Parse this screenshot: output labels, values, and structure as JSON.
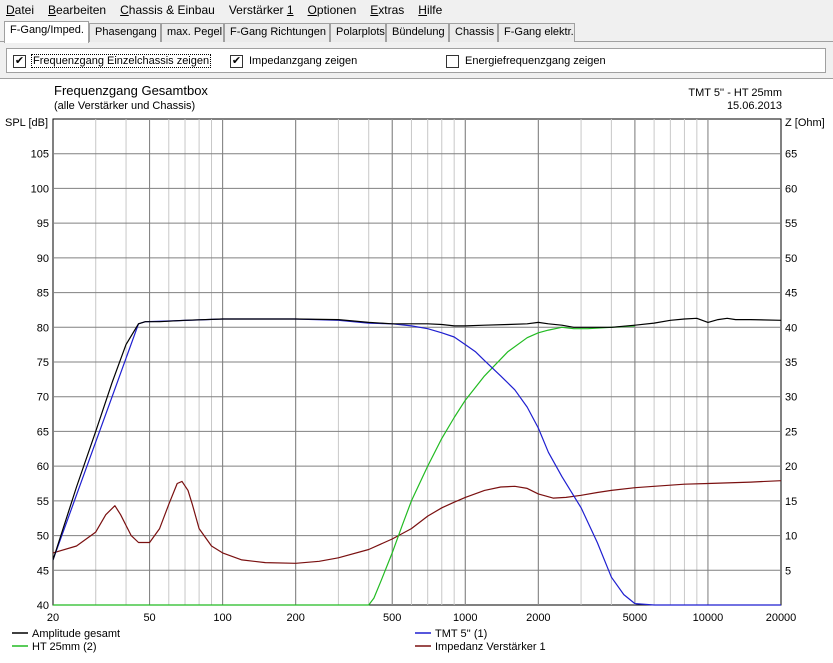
{
  "menu": {
    "items": [
      {
        "label": "Datei",
        "u": "D",
        "rest": "atei"
      },
      {
        "label": "Bearbeiten",
        "u": "B",
        "rest": "earbeiten"
      },
      {
        "label": "Chassis & Einbau",
        "u": "C",
        "rest": "hassis & Einbau"
      },
      {
        "label": "Verstärker 1",
        "u": "",
        "rest": "Verstärker 1"
      },
      {
        "label": "Optionen",
        "u": "O",
        "rest": "ptionen"
      },
      {
        "label": "Extras",
        "u": "E",
        "rest": "xtras"
      },
      {
        "label": "Hilfe",
        "u": "H",
        "rest": "ilfe"
      }
    ]
  },
  "tabs": [
    {
      "label": "F-Gang/Imped.",
      "active": true
    },
    {
      "label": "Phasengang",
      "active": false
    },
    {
      "label": "max. Pegel",
      "active": false
    },
    {
      "label": "F-Gang Richtungen",
      "active": false
    },
    {
      "label": "Polarplots",
      "active": false
    },
    {
      "label": "Bündelung",
      "active": false
    },
    {
      "label": "Chassis",
      "active": false
    },
    {
      "label": "F-Gang elektr.",
      "active": false
    }
  ],
  "options": {
    "show_chassis": {
      "label": "Frequenzgang Einzelchassis zeigen",
      "checked": true
    },
    "show_impedance": {
      "label": "Impedanzgang zeigen",
      "checked": true
    },
    "show_energy": {
      "label": "Energiefrequenzgang zeigen",
      "checked": false
    }
  },
  "chart_data": {
    "type": "line",
    "title": "Frequenzgang Gesamtbox",
    "subtitle": "(alle Verstärker und Chassis)",
    "info_line1": "TMT 5'' - HT 25mm",
    "info_line2": "15.06.2013",
    "ylabel": "SPL [dB]",
    "y2label": "Z [Ohm]",
    "x_scale": "log",
    "xlim": [
      20,
      20000
    ],
    "ylim": [
      40,
      110
    ],
    "y2lim": [
      0,
      70
    ],
    "x_ticks": [
      20,
      50,
      100,
      200,
      500,
      1000,
      2000,
      5000,
      10000,
      20000
    ],
    "y_ticks": [
      40,
      45,
      50,
      55,
      60,
      65,
      70,
      75,
      80,
      85,
      90,
      95,
      100,
      105
    ],
    "y2_ticks": [
      5,
      10,
      15,
      20,
      25,
      30,
      35,
      40,
      45,
      50,
      55,
      60,
      65
    ],
    "grid": true,
    "legend_position": "bottom",
    "series": [
      {
        "name": "Amplitude gesamt",
        "color": "#000000",
        "axis": "left",
        "x": [
          20,
          25,
          30,
          35,
          40,
          45,
          48,
          55,
          70,
          100,
          150,
          200,
          300,
          400,
          500,
          600,
          700,
          800,
          900,
          1000,
          1200,
          1500,
          1800,
          2000,
          2200,
          2500,
          2800,
          3200,
          4000,
          5000,
          6000,
          7000,
          8000,
          9000,
          10000,
          11000,
          12000,
          13000,
          15000,
          20000
        ],
        "y": [
          46.5,
          57,
          65,
          72,
          77.5,
          80.5,
          80.8,
          80.8,
          81.0,
          81.2,
          81.2,
          81.2,
          81.1,
          80.7,
          80.5,
          80.5,
          80.5,
          80.4,
          80.2,
          80.2,
          80.3,
          80.4,
          80.5,
          80.7,
          80.5,
          80.3,
          80.0,
          80.0,
          80.0,
          80.3,
          80.6,
          81.0,
          81.2,
          81.3,
          80.7,
          81.1,
          81.3,
          81.1,
          81.1,
          81.0
        ]
      },
      {
        "name": "TMT 5'' (1)",
        "color": "#1f1fd0",
        "axis": "left",
        "x": [
          20,
          45,
          48,
          60,
          100,
          200,
          300,
          400,
          500,
          600,
          700,
          800,
          900,
          1000,
          1100,
          1200,
          1400,
          1600,
          1800,
          2000,
          2200,
          2500,
          3000,
          3500,
          4000,
          4500,
          5000,
          6000,
          10000,
          20000
        ],
        "y": [
          46.5,
          80.5,
          80.8,
          80.9,
          81.2,
          81.2,
          81.0,
          80.6,
          80.5,
          80.2,
          79.8,
          79.2,
          78.6,
          77.5,
          76.5,
          75.2,
          73.0,
          71.0,
          68.5,
          65.5,
          62.0,
          58.5,
          54.0,
          49.0,
          44.0,
          41.5,
          40.2,
          40.0,
          40.0,
          40.0
        ]
      },
      {
        "name": "HT 25mm (2)",
        "color": "#22bb22",
        "axis": "left",
        "x": [
          20,
          300,
          400,
          420,
          450,
          500,
          550,
          600,
          700,
          800,
          900,
          1000,
          1200,
          1500,
          1800,
          2000,
          2200,
          2500,
          2800,
          3200,
          4000,
          5000
        ],
        "y": [
          40,
          40,
          40,
          41,
          43.5,
          47.5,
          51.5,
          55,
          60,
          64,
          67,
          69.5,
          73,
          76.5,
          78.5,
          79.2,
          79.6,
          80.0,
          79.8,
          79.8,
          80.0,
          80.2
        ]
      },
      {
        "name": "Impedanz Verstärker 1",
        "color": "#7a1010",
        "axis": "right",
        "x": [
          20,
          25,
          30,
          33,
          36,
          38,
          42,
          45,
          50,
          55,
          60,
          65,
          68,
          72,
          75,
          80,
          90,
          100,
          120,
          150,
          200,
          250,
          300,
          400,
          500,
          600,
          700,
          800,
          900,
          1000,
          1200,
          1400,
          1600,
          1800,
          2000,
          2300,
          2600,
          3000,
          3500,
          4000,
          5000,
          6000,
          8000,
          10000,
          15000,
          20000
        ],
        "y": [
          7.5,
          8.5,
          10.5,
          13,
          14.3,
          13,
          10,
          9,
          9,
          11,
          14.5,
          17.5,
          17.8,
          16.5,
          14.5,
          11,
          8.5,
          7.5,
          6.5,
          6.1,
          6.0,
          6.3,
          6.8,
          8.0,
          9.5,
          11,
          12.8,
          14.0,
          14.8,
          15.5,
          16.5,
          17.0,
          17.1,
          16.8,
          16.0,
          15.4,
          15.5,
          15.8,
          16.2,
          16.5,
          16.9,
          17.1,
          17.4,
          17.5,
          17.7,
          17.9
        ]
      }
    ]
  }
}
